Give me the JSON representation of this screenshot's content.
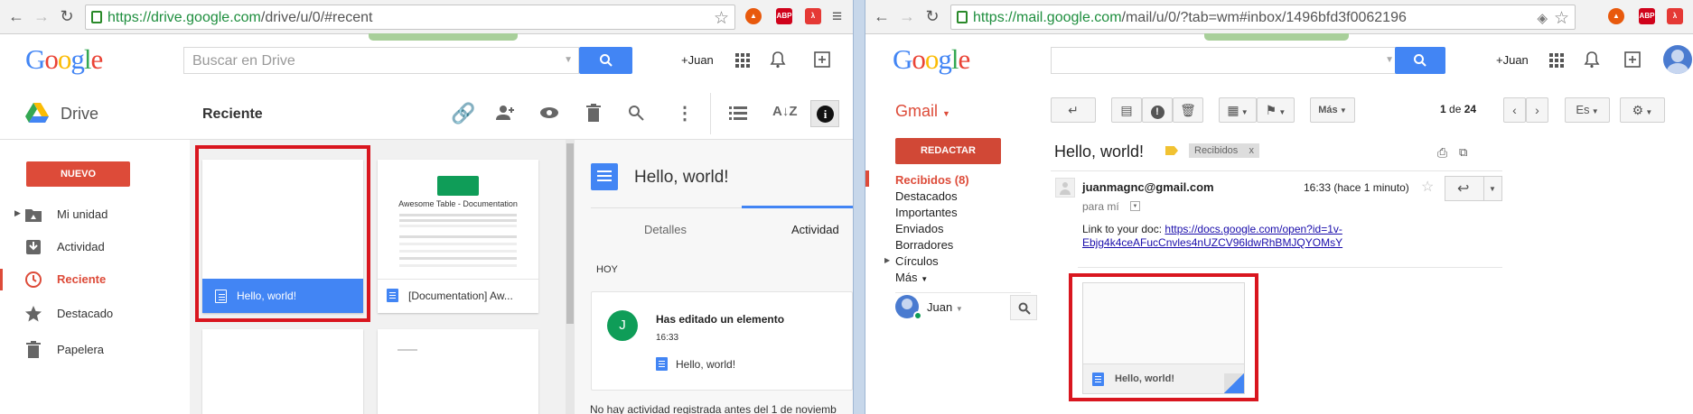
{
  "drive_window": {
    "url_host": "https://drive.google.com",
    "url_path": "/drive/u/0/#recent",
    "logo": [
      "G",
      "o",
      "o",
      "g",
      "l",
      "e"
    ],
    "search_placeholder": "Buscar en Drive",
    "user": "+Juan",
    "app_name": "Drive",
    "view_title": "Reciente",
    "new_button": "NUEVO",
    "nav": [
      {
        "label": "Mi unidad",
        "icon": "my-drive-icon"
      },
      {
        "label": "Actividad",
        "icon": "activity-icon"
      },
      {
        "label": "Reciente",
        "icon": "recent-clock-icon",
        "active": true
      },
      {
        "label": "Destacado",
        "icon": "star-icon"
      },
      {
        "label": "Papelera",
        "icon": "trash-icon"
      }
    ],
    "files": [
      {
        "name": "Hello, world!",
        "selected": true
      },
      {
        "name": "[Documentation] Aw...",
        "thumb_title": "Awesome Table - Documentation"
      }
    ],
    "detail": {
      "doc_title": "Hello, world!",
      "tabs": [
        "Detalles",
        "Actividad"
      ],
      "active_tab": "Actividad",
      "section": "HOY",
      "activity_title": "Has editado un elemento",
      "activity_time": "16:33",
      "activity_file": "Hello, world!",
      "avatar_letter": "J",
      "footer": "No hay actividad registrada antes del 1 de noviemb"
    }
  },
  "gmail_window": {
    "url_host": "https://mail.google.com",
    "url_path": "/mail/u/0/?tab=wm#inbox/1496bfd3f0062196",
    "logo": [
      "G",
      "o",
      "o",
      "g",
      "l",
      "e"
    ],
    "user": "+Juan",
    "app_name": "Gmail",
    "more_button": "Más",
    "pager": {
      "current": "1",
      "of": "de",
      "total": "24"
    },
    "lang_button": "Es",
    "compose": "REDACTAR",
    "labels": [
      "Recibidos (8)",
      "Destacados",
      "Importantes",
      "Enviados",
      "Borradores",
      "Círculos",
      "Más"
    ],
    "chat_user": "Juan",
    "message": {
      "subject": "Hello, world!",
      "label_chip": "Recibidos",
      "label_chip_close": "x",
      "sender": "juanmagnc@gmail.com",
      "time": "16:33 (hace 1 minuto)",
      "to": "para mí",
      "body_prefix": "Link to your doc:",
      "link_line1": "https://docs.google.com/open?id=1v-",
      "link_line2": "Ebjg4k4ceAFucCnvles4nUZCV96ldwRhBMJQYOMsY",
      "attachment_name": "Hello, world!"
    }
  },
  "colors": {
    "accent_blue": "#4285f4",
    "drive_red": "#dd4b39",
    "gmail_red": "#d14836",
    "highlight_box": "#d9161f",
    "link": "#1a0dab"
  }
}
